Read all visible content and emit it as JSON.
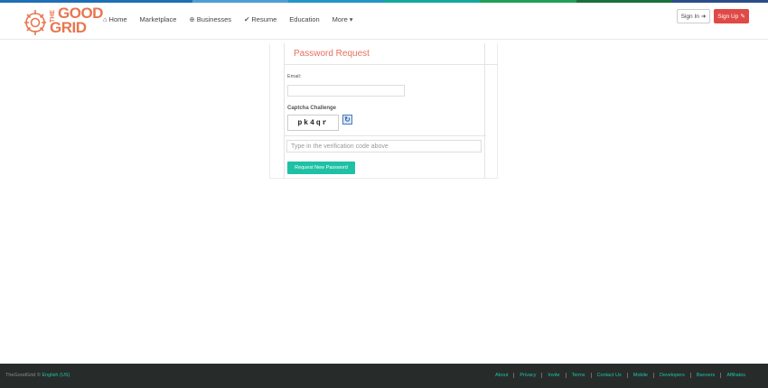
{
  "brand": {
    "logo_the": "THE",
    "logo_good": "GOOD",
    "logo_grid": "GRID",
    "accent": "#e8764f",
    "strip_colors": [
      "#1f6fb5",
      "#1f6fb5",
      "#4d9fd3",
      "#2196c6",
      "#13a89e",
      "#21a053",
      "#1c6f3c",
      "#2a4d8a"
    ]
  },
  "nav": {
    "items": [
      {
        "label": "Home",
        "icon": "home-icon",
        "glyph": "⌂"
      },
      {
        "label": "Marketplace",
        "icon": "",
        "glyph": ""
      },
      {
        "label": "Businesses",
        "icon": "globe-icon",
        "glyph": "⊕"
      },
      {
        "label": "Resume",
        "icon": "check-icon",
        "glyph": "✔"
      },
      {
        "label": "Education",
        "icon": "",
        "glyph": ""
      },
      {
        "label": "More",
        "icon": "caret-down-icon",
        "glyph": "▾"
      }
    ]
  },
  "auth": {
    "signin_label": "Sign In",
    "signup_label": "Sign Up",
    "signup_color": "#e04a46"
  },
  "form": {
    "title": "Password Request",
    "email_label": "Email:",
    "email_value": "",
    "captcha_label": "Captcha Challenge",
    "captcha_text": "pk4qr",
    "verify_placeholder": "Type in the verification code above",
    "submit_label": "Request New Password",
    "button_color": "#1fc1a5"
  },
  "footer": {
    "brand": "TheGoodGrid ©",
    "language": "English (US)",
    "links": [
      "About",
      "Privacy",
      "Invite",
      "Terms",
      "Contact Us",
      "Mobile",
      "Developers",
      "Banners",
      "Affiliates"
    ]
  }
}
